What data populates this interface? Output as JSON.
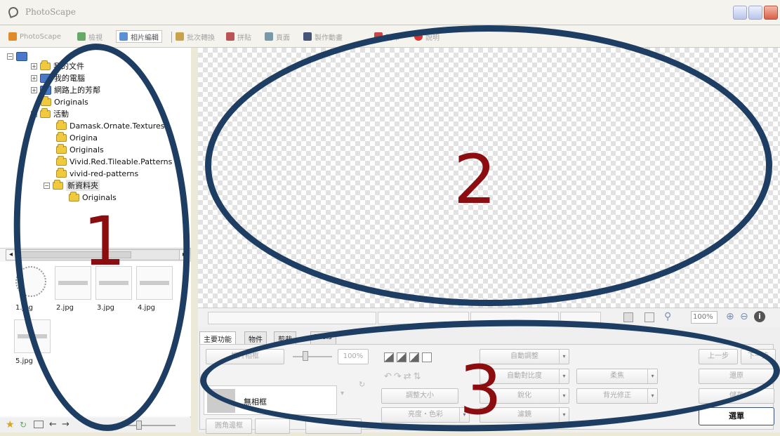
{
  "window": {
    "title": "PhotoScape"
  },
  "toolbar": {
    "tabs": [
      {
        "label": "PhotoScape"
      },
      {
        "label": "檢視"
      },
      {
        "label": "相片編輯"
      },
      {
        "label": "批次轉換"
      },
      {
        "label": "拼貼"
      },
      {
        "label": "頁面"
      },
      {
        "label": "製作動畫"
      },
      {
        "label": "列印"
      },
      {
        "label": "說明"
      }
    ]
  },
  "tree": {
    "nodes": [
      {
        "label": "我的文件"
      },
      {
        "label": "我的電腦"
      },
      {
        "label": "網路上的芳鄰"
      },
      {
        "label": "Originals"
      },
      {
        "label": "活動"
      },
      {
        "label": "Damask.Ornate.Textures"
      },
      {
        "label": "Origina"
      },
      {
        "label": "Originals"
      },
      {
        "label": "Vivid.Red.Tileable.Patterns"
      },
      {
        "label": "vivid-red-patterns"
      },
      {
        "label": "新資料夾"
      },
      {
        "label": "Originals"
      }
    ]
  },
  "thumbnails": [
    {
      "label": "1.jpg"
    },
    {
      "label": "2.jpg"
    },
    {
      "label": "3.jpg"
    },
    {
      "label": "4.jpg"
    },
    {
      "label": "5.jpg"
    }
  ],
  "statusbar": {
    "zoom": "100%"
  },
  "panel": {
    "tabs": [
      {
        "label": "主要功能"
      },
      {
        "label": "物件"
      },
      {
        "label": "剪裁"
      },
      {
        "label": "Tools"
      }
    ],
    "photo_frame_button": "相片相框",
    "percent_field": "100%",
    "frame_value": "無相框",
    "round_corner_button": "圓角邊框",
    "resize_button": "調整大小",
    "brightness_button": "亮度・色彩",
    "auto_level": "自動調整",
    "contrast": "自動對比度",
    "sharpen": "銳化",
    "filter": "濾鏡",
    "bloom": "柔焦",
    "backlight": "背光修正",
    "undo": "上一步",
    "redo": "下一步",
    "restore": "還原",
    "save": "儲存",
    "menu": "選單"
  },
  "annotations": [
    {
      "number": "1"
    },
    {
      "number": "2"
    },
    {
      "number": "3"
    }
  ],
  "colors": {
    "ellipse": "#1d3e62",
    "annotation_number": "#8b0d10"
  }
}
